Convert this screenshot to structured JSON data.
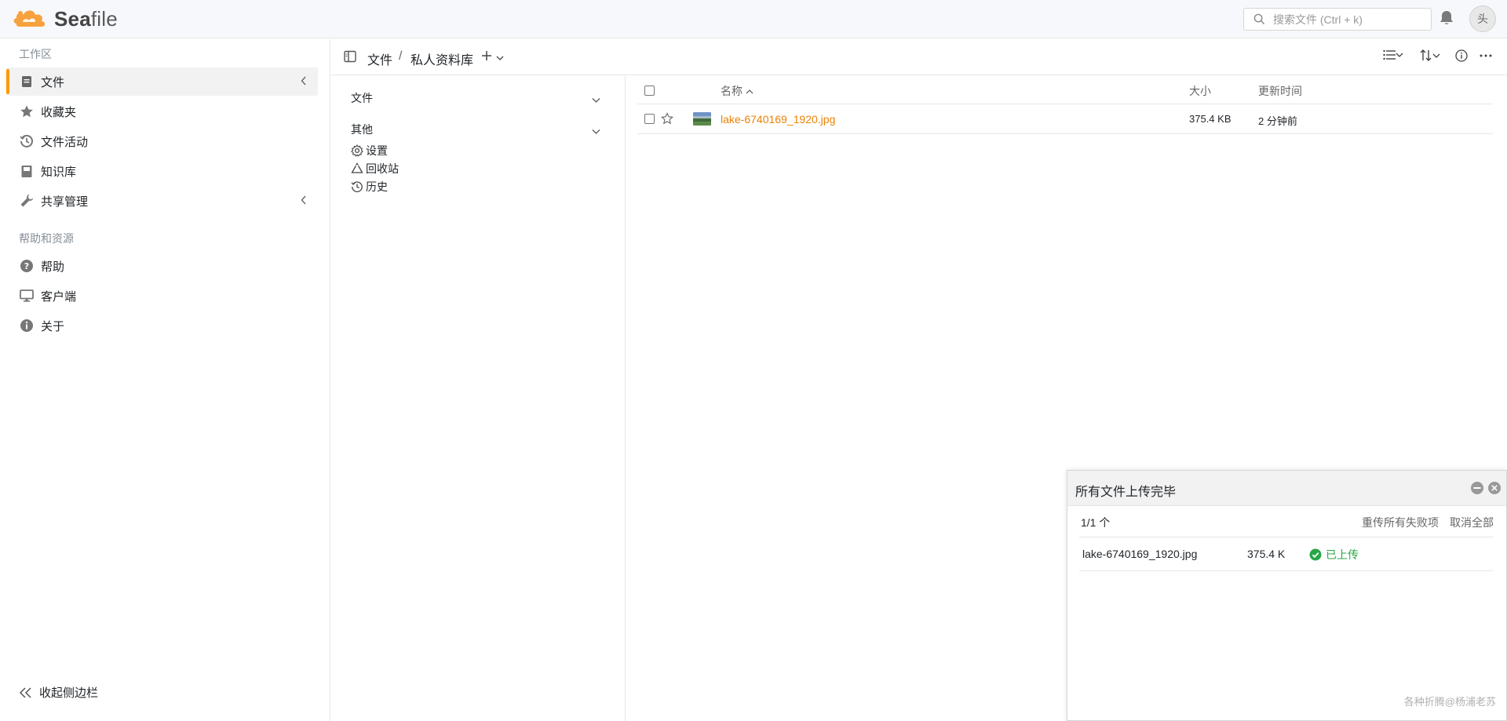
{
  "app": {
    "logo_prefix": "Sea",
    "logo_suffix": "file",
    "brand_color": "#f7a23d"
  },
  "header": {
    "search_placeholder": "搜索文件 (Ctrl + k)",
    "avatar_alt": "头"
  },
  "sidebar": {
    "workspace_heading": "工作区",
    "items": [
      {
        "label": "文件",
        "icon": "file-icon",
        "active": true,
        "has_caret": true
      },
      {
        "label": "收藏夹",
        "icon": "star-icon"
      },
      {
        "label": "文件活动",
        "icon": "history-icon"
      },
      {
        "label": "知识库",
        "icon": "book-icon"
      },
      {
        "label": "共享管理",
        "icon": "wrench-icon",
        "has_caret": true
      }
    ],
    "help_heading": "帮助和资源",
    "help_items": [
      {
        "label": "帮助",
        "icon": "help-icon"
      },
      {
        "label": "客户端",
        "icon": "monitor-icon"
      },
      {
        "label": "关于",
        "icon": "info-icon"
      }
    ],
    "collapse_label": "收起侧边栏"
  },
  "path": {
    "root": "文件",
    "separator": "/",
    "library": "私人资料库"
  },
  "tree": {
    "files_section": "文件",
    "other_section": "其他",
    "items": [
      {
        "label": "设置",
        "icon": "gear-icon"
      },
      {
        "label": "回收站",
        "icon": "recycle-icon"
      },
      {
        "label": "历史",
        "icon": "history-icon"
      }
    ]
  },
  "table": {
    "headers": {
      "name": "名称",
      "size": "大小",
      "updated": "更新时间"
    },
    "rows": [
      {
        "name": "lake-6740169_1920.jpg",
        "size": "375.4 KB",
        "updated": "2 分钟前"
      }
    ]
  },
  "upload": {
    "title": "所有文件上传完毕",
    "count": "1/1 个",
    "retry_all": "重传所有失败项",
    "cancel_all": "取消全部",
    "items": [
      {
        "name": "lake-6740169_1920.jpg",
        "size": "375.4 K",
        "status": "已上传"
      }
    ],
    "success_color": "#28a745"
  },
  "watermark": "各种折腾@杨浦老苏"
}
